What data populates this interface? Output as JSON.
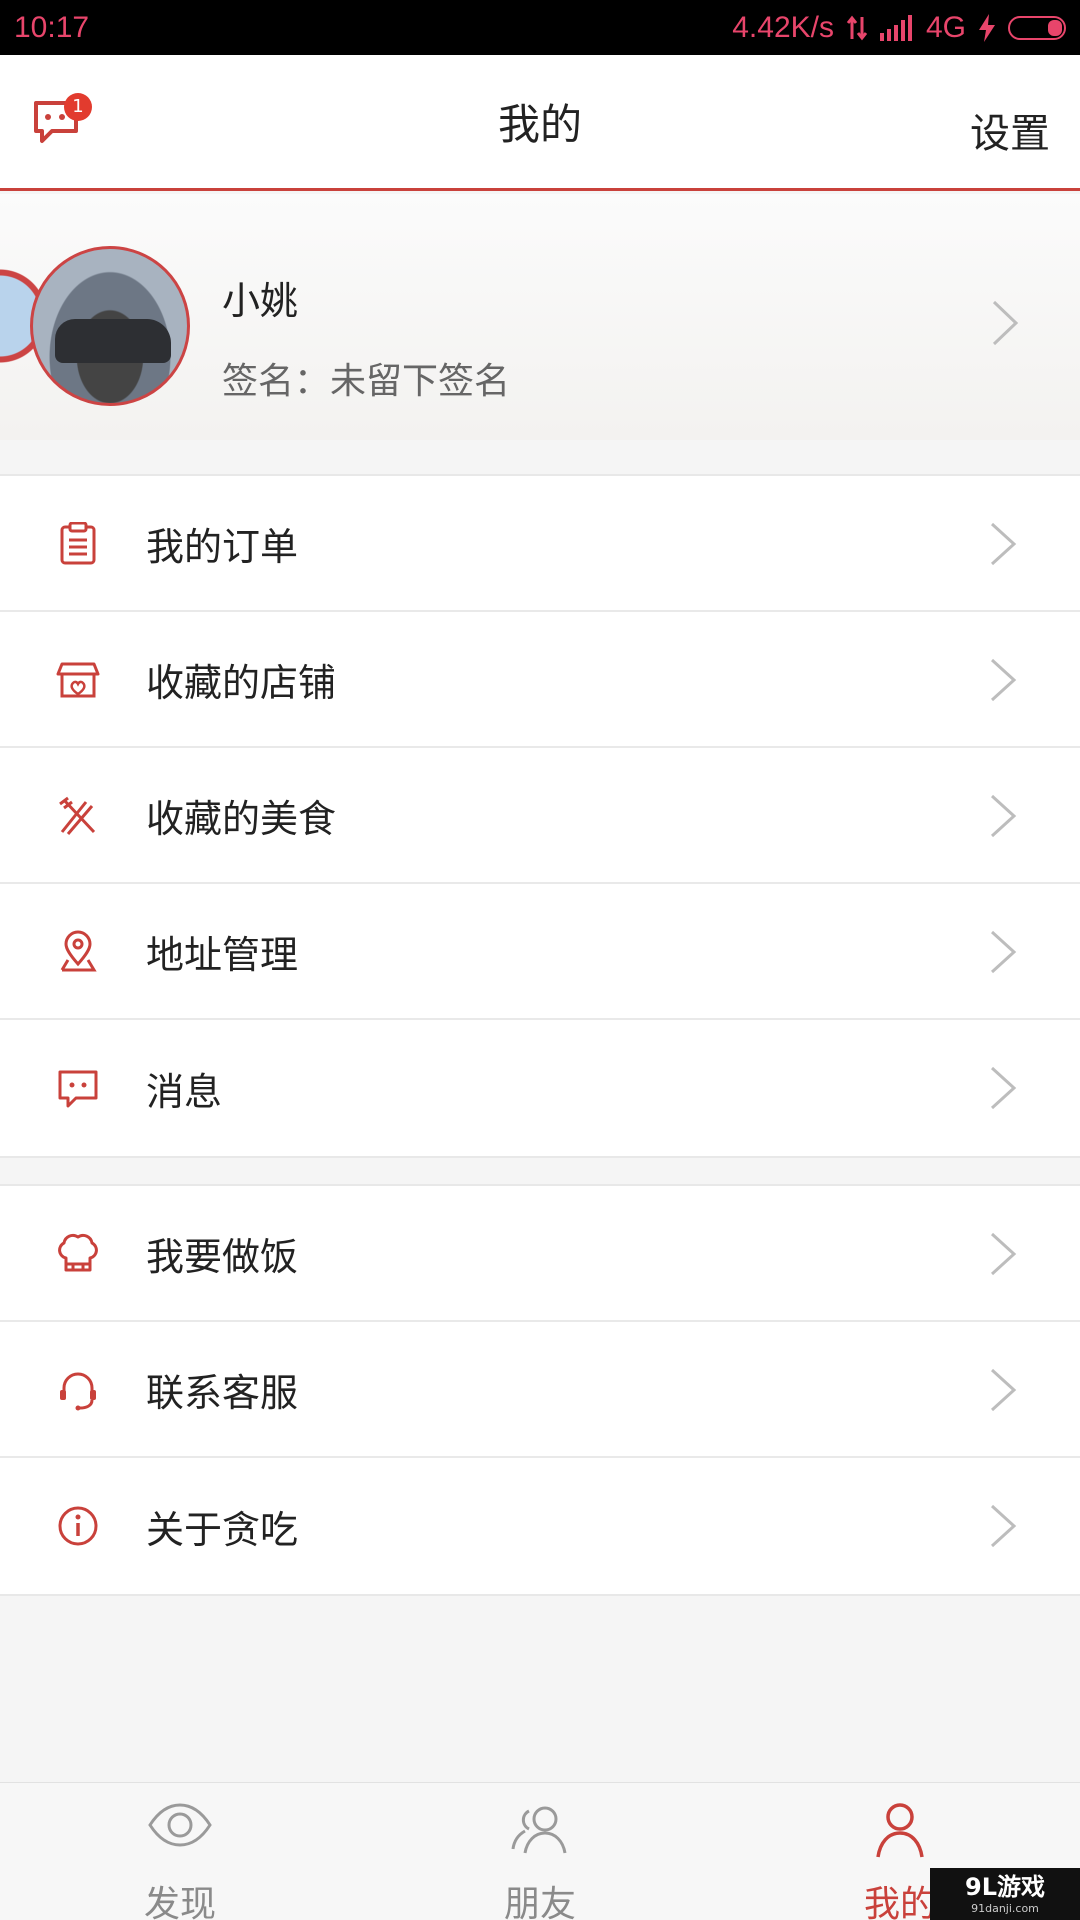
{
  "status": {
    "time": "10:17",
    "speed": "4.42K/s",
    "network": "4G"
  },
  "header": {
    "title": "我的",
    "settings": "设置",
    "badge": "1"
  },
  "profile": {
    "name": "小姚",
    "signature": "签名：未留下签名"
  },
  "menu_group_1": [
    {
      "label": "我的订单",
      "icon": "clipboard-icon"
    },
    {
      "label": "收藏的店铺",
      "icon": "store-icon"
    },
    {
      "label": "收藏的美食",
      "icon": "utensils-icon"
    },
    {
      "label": "地址管理",
      "icon": "location-icon"
    },
    {
      "label": "消息",
      "icon": "message-icon"
    }
  ],
  "menu_group_2": [
    {
      "label": "我要做饭",
      "icon": "chef-hat-icon"
    },
    {
      "label": "联系客服",
      "icon": "headset-icon"
    },
    {
      "label": "关于贪吃",
      "icon": "info-icon"
    }
  ],
  "tabs": [
    {
      "label": "发现",
      "icon": "eye-icon",
      "active": false
    },
    {
      "label": "朋友",
      "icon": "friends-icon",
      "active": false
    },
    {
      "label": "我的",
      "icon": "person-icon",
      "active": true
    }
  ],
  "watermark": {
    "main": "9L游戏",
    "sub": "91danji.com"
  },
  "colors": {
    "accent": "#c9413b",
    "status_text": "#e8456b"
  }
}
